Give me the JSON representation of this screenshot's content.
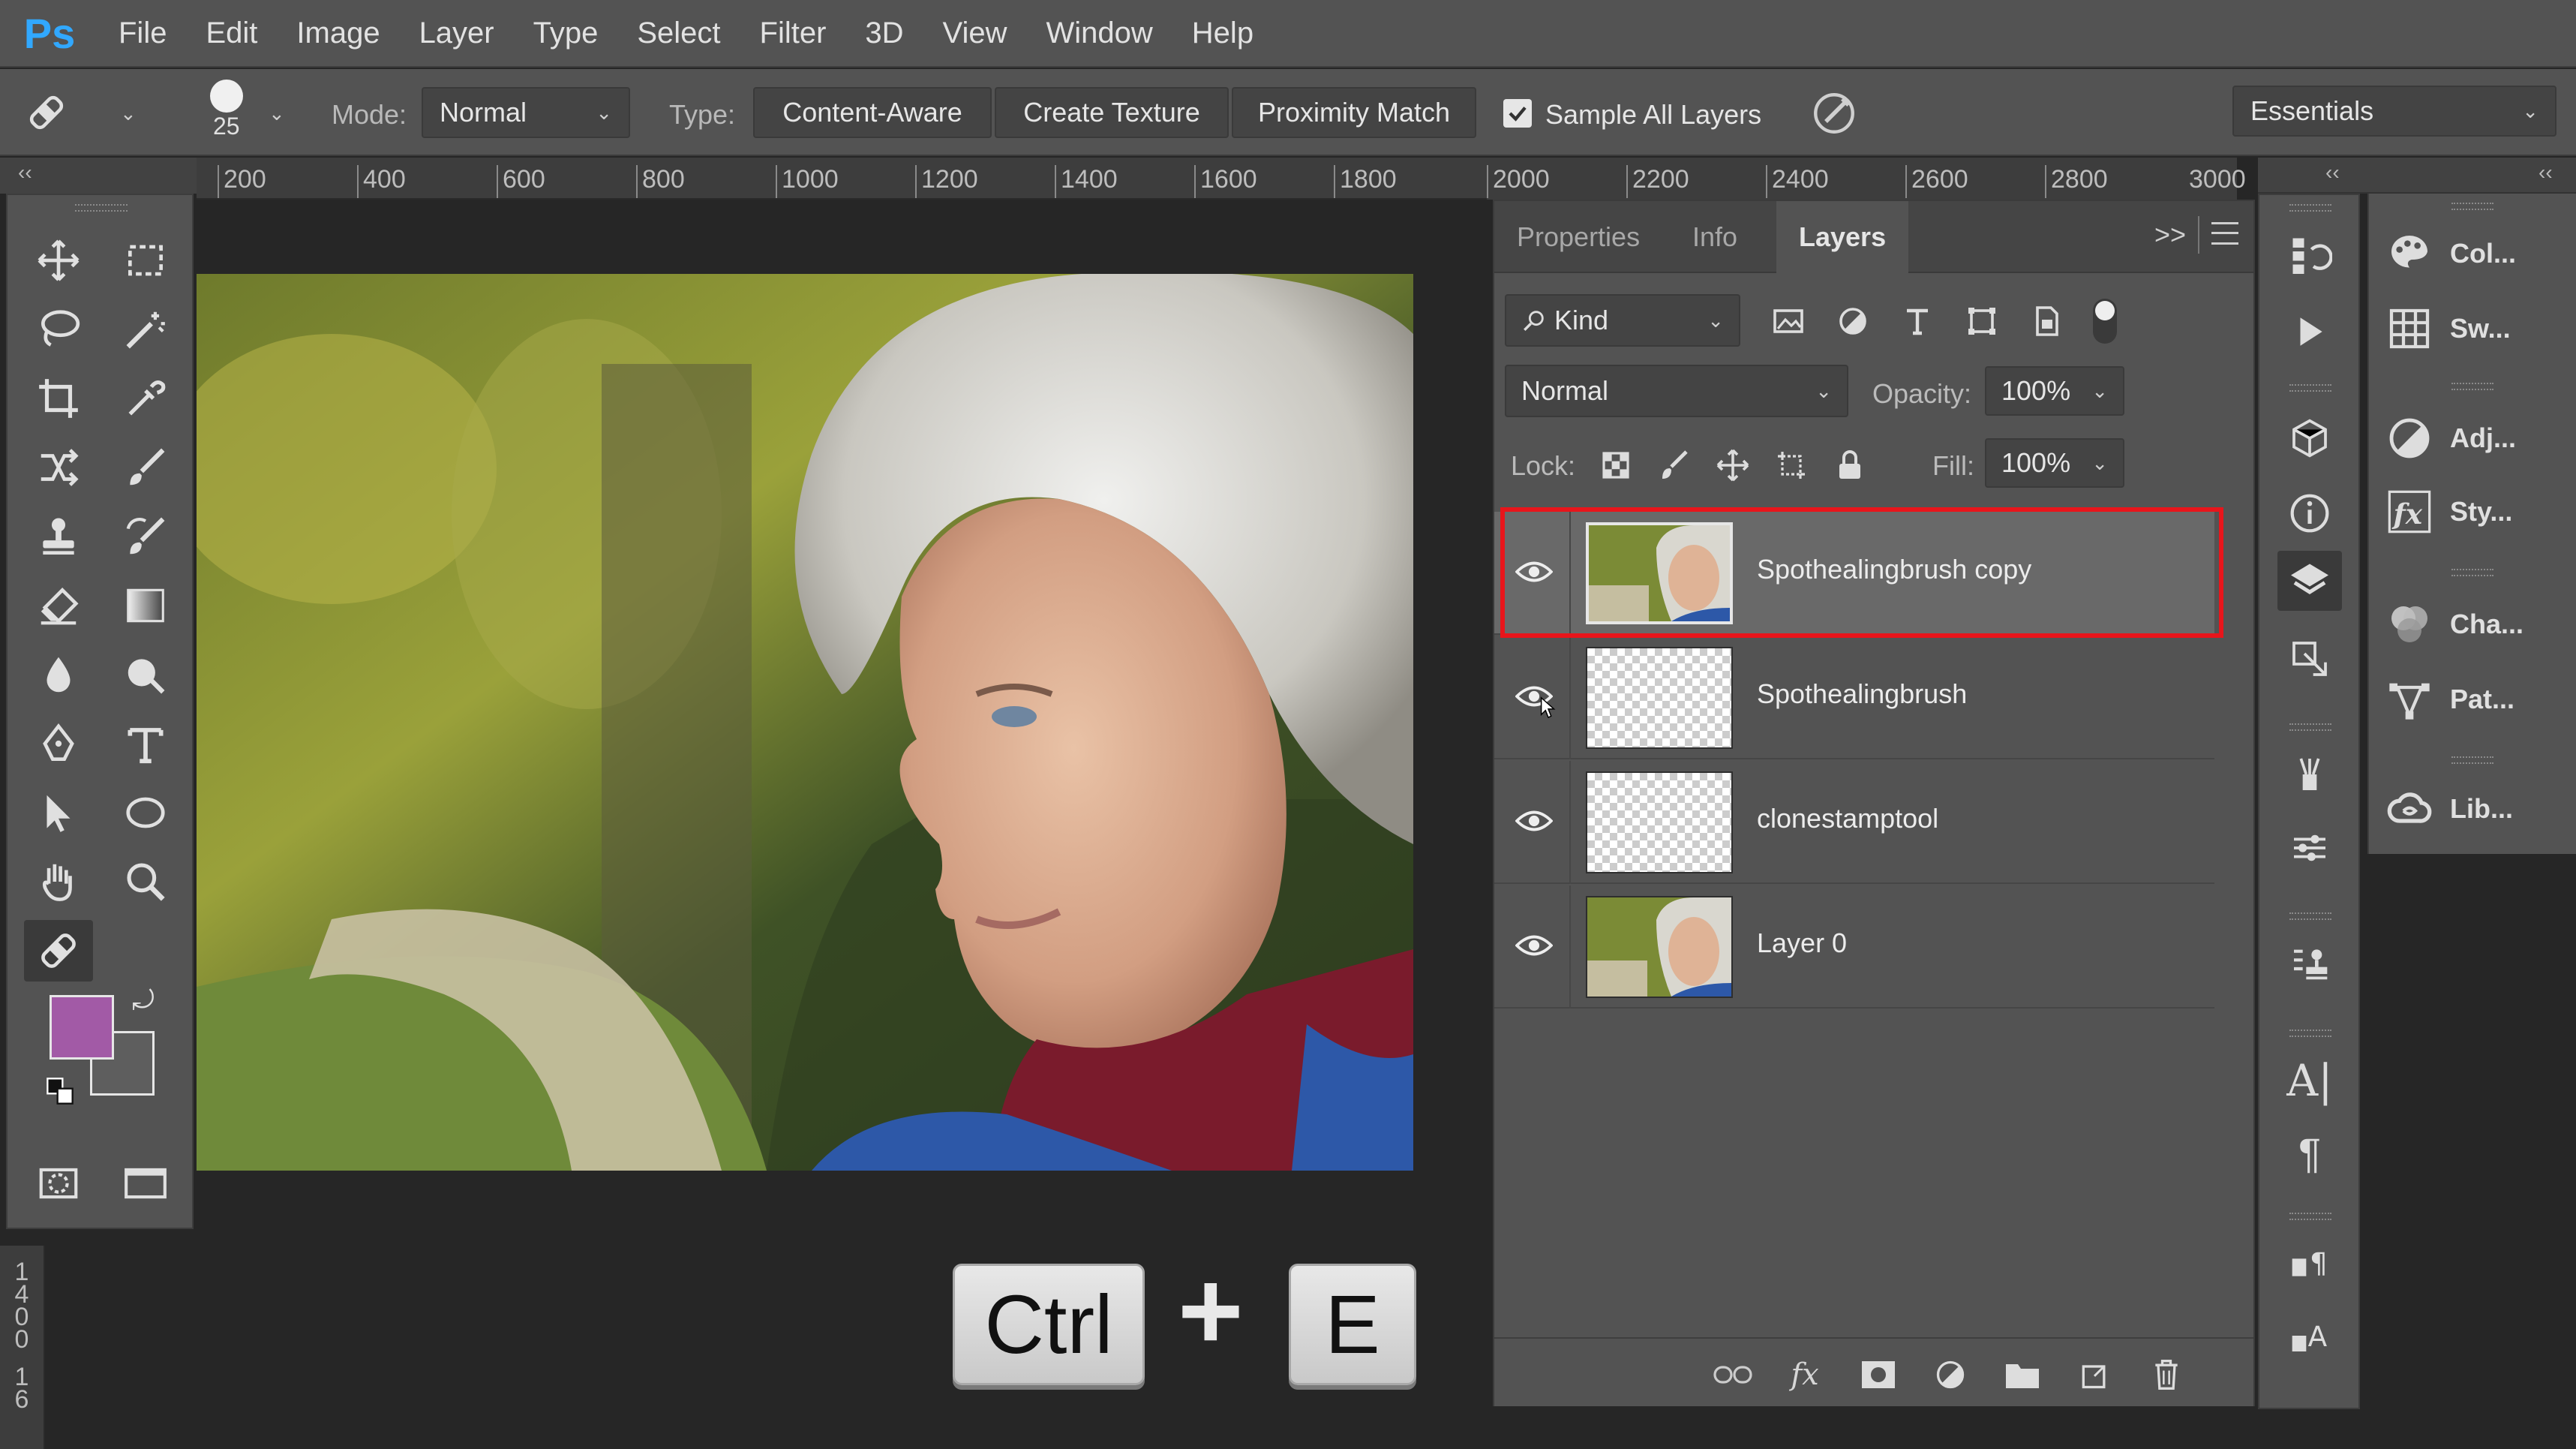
{
  "app": {
    "logo": "Ps"
  },
  "menu": [
    "File",
    "Edit",
    "Image",
    "Layer",
    "Type",
    "Select",
    "Filter",
    "3D",
    "View",
    "Window",
    "Help"
  ],
  "options": {
    "brush_size": "25",
    "mode_label": "Mode:",
    "mode_value": "Normal",
    "type_label": "Type:",
    "type_buttons": [
      "Content-Aware",
      "Create Texture",
      "Proximity Match"
    ],
    "sample_all_layers": "Sample All Layers",
    "workspace": "Essentials"
  },
  "ruler": {
    "h": [
      "200",
      "400",
      "600",
      "800",
      "1000",
      "1200",
      "1400",
      "1600",
      "1800",
      "2000",
      "2200",
      "2400",
      "2600",
      "2800",
      "3000"
    ],
    "v": [
      "1",
      "4",
      "0",
      "0",
      "1",
      "6"
    ]
  },
  "colors": {
    "foreground": "#a25aa6",
    "background": "#5e5e5e",
    "highlight": "#e8151b",
    "ps_blue": "#31a8ff"
  },
  "keys": {
    "ctrl": "Ctrl",
    "plus": "+",
    "e": "E"
  },
  "panel": {
    "tabs": [
      "Properties",
      "Info",
      "Layers"
    ],
    "kind_label": "Kind",
    "blend_mode": "Normal",
    "opacity_label": "Opacity:",
    "opacity_value": "100%",
    "lock_label": "Lock:",
    "fill_label": "Fill:",
    "fill_value": "100%",
    "collapse": ">>",
    "layers": [
      {
        "name": "Spothealingbrush copy",
        "thumb": "photo",
        "visible": true,
        "selected": true
      },
      {
        "name": "Spothealingbrush",
        "thumb": "transparent",
        "visible": true,
        "selected": false
      },
      {
        "name": "clonestamptool",
        "thumb": "transparent",
        "visible": true,
        "selected": false
      },
      {
        "name": "Layer 0",
        "thumb": "photo",
        "visible": true,
        "selected": false
      }
    ]
  },
  "side_panels": [
    "Col...",
    "Sw...",
    "Adj...",
    "Sty...",
    "Cha...",
    "Pat...",
    "Lib..."
  ]
}
